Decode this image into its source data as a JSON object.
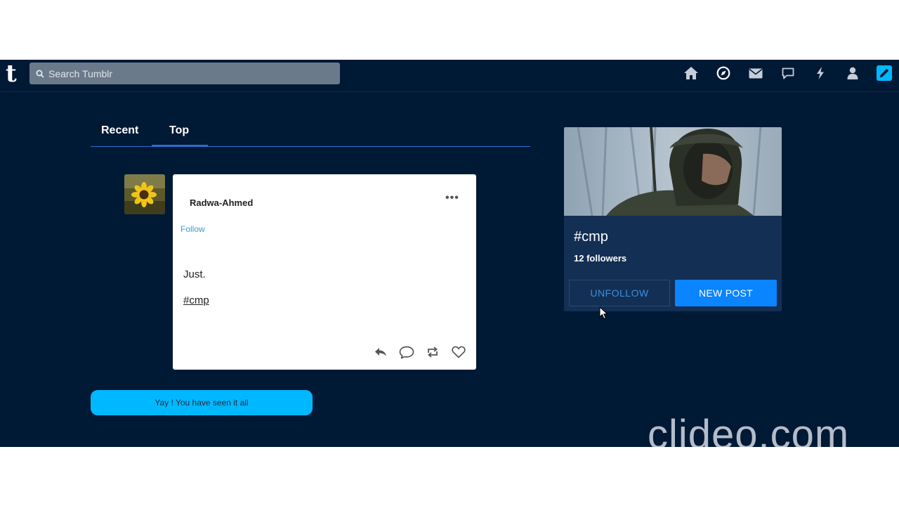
{
  "navbar": {
    "logo_letter": "t",
    "search_placeholder": "Search Tumblr",
    "icons": [
      "home-icon",
      "explore-icon",
      "inbox-icon",
      "messages-icon",
      "activity-icon",
      "account-icon",
      "compose-icon"
    ]
  },
  "tabs": [
    {
      "label": "Recent",
      "active": false
    },
    {
      "label": "Top",
      "active": true
    }
  ],
  "post": {
    "author": "Radwa-Ahmed",
    "follow_label": "Follow",
    "menu_label": "•••",
    "text": "Just.",
    "tag": "#cmp"
  },
  "end_message": "Yay ! You have seen it all",
  "tag_card": {
    "tag": "#cmp",
    "followers": "12 followers",
    "unfollow_label": "UNFOLLOW",
    "new_post_label": "NEW POST"
  },
  "watermark": "clideo.com",
  "colors": {
    "background": "#001935",
    "accent": "#00b8ff",
    "button_primary": "#0a84ff",
    "card": "#132f54"
  }
}
